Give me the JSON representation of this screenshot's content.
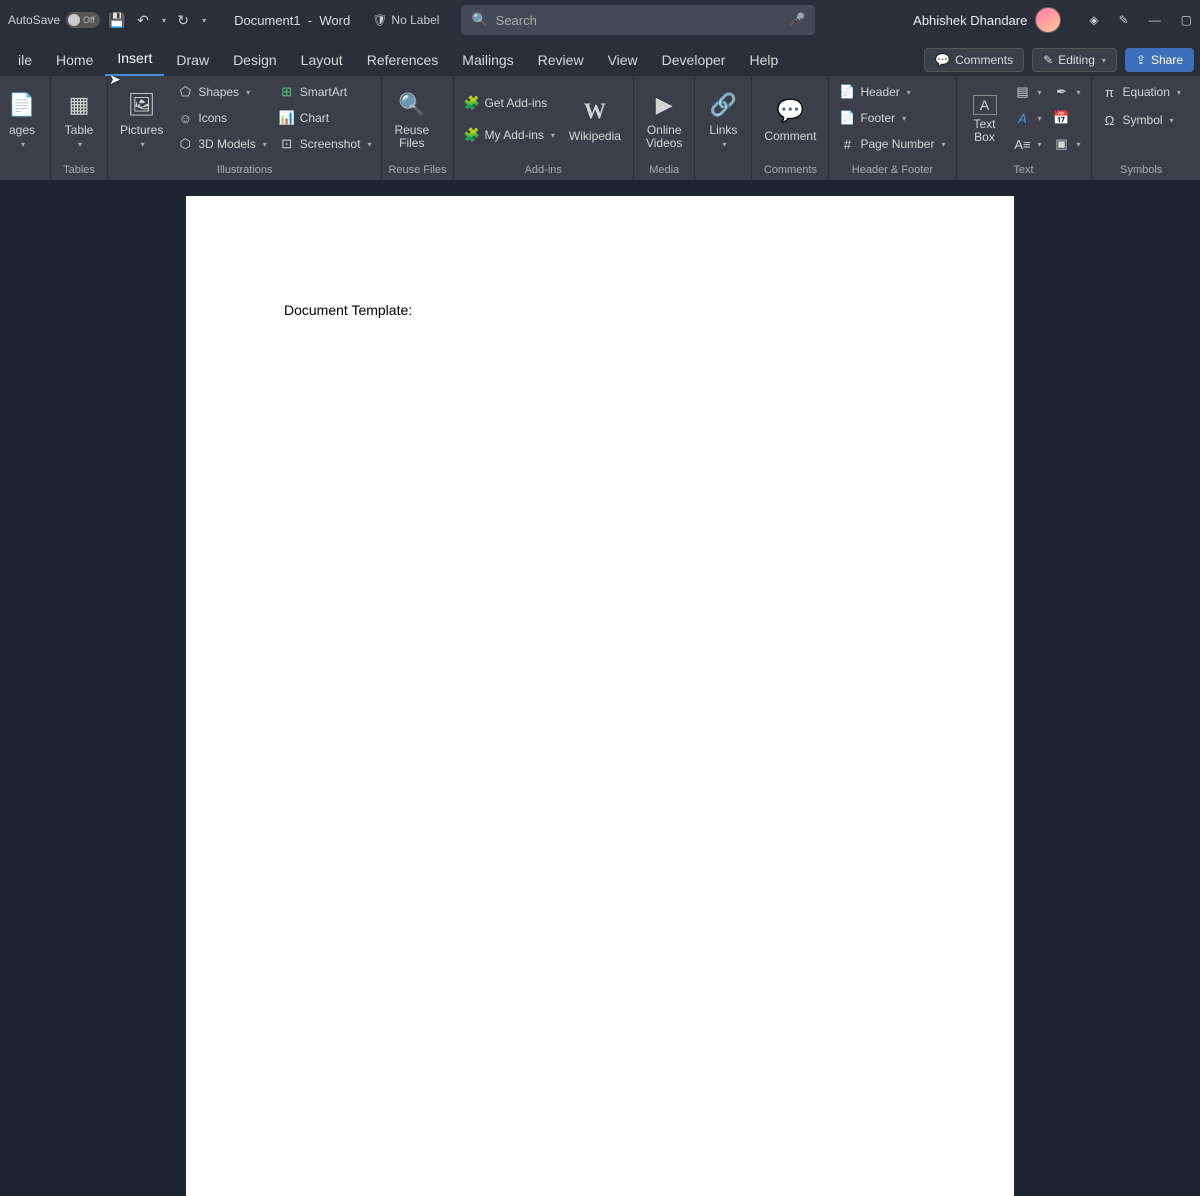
{
  "titlebar": {
    "autosave_label": "AutoSave",
    "autosave_state": "Off",
    "doc_name": "Document1",
    "app_name": "Word",
    "no_label": "No Label",
    "search_placeholder": "Search",
    "user_name": "Abhishek Dhandare"
  },
  "tabs": {
    "items": [
      "ile",
      "Home",
      "Insert",
      "Draw",
      "Design",
      "Layout",
      "References",
      "Mailings",
      "Review",
      "View",
      "Developer",
      "Help"
    ],
    "active": "Insert",
    "comments": "Comments",
    "editing": "Editing",
    "share": "Share"
  },
  "ribbon": {
    "pages": {
      "label": "ages"
    },
    "tables": {
      "big": "Table",
      "group": "Tables"
    },
    "illustrations": {
      "pictures": "Pictures",
      "shapes": "Shapes",
      "icons": "Icons",
      "models": "3D Models",
      "smartart": "SmartArt",
      "chart": "Chart",
      "screenshot": "Screenshot",
      "group": "Illustrations"
    },
    "reuse": {
      "big": "Reuse\nFiles",
      "group": "Reuse Files"
    },
    "addins": {
      "get": "Get Add-ins",
      "my": "My Add-ins",
      "wiki": "Wikipedia",
      "group": "Add-ins"
    },
    "media": {
      "big": "Online\nVideos",
      "group": "Media"
    },
    "links": {
      "big": "Links"
    },
    "comments": {
      "big": "Comment",
      "group": "Comments"
    },
    "hf": {
      "header": "Header",
      "footer": "Footer",
      "pagenum": "Page Number",
      "group": "Header & Footer"
    },
    "text": {
      "textbox": "Text\nBox",
      "group": "Text"
    },
    "symbols": {
      "equation": "Equation",
      "symbol": "Symbol",
      "group": "Symbols"
    }
  },
  "document": {
    "content": "Document Template:"
  },
  "colors": {
    "accent": "#4a8fd8"
  }
}
